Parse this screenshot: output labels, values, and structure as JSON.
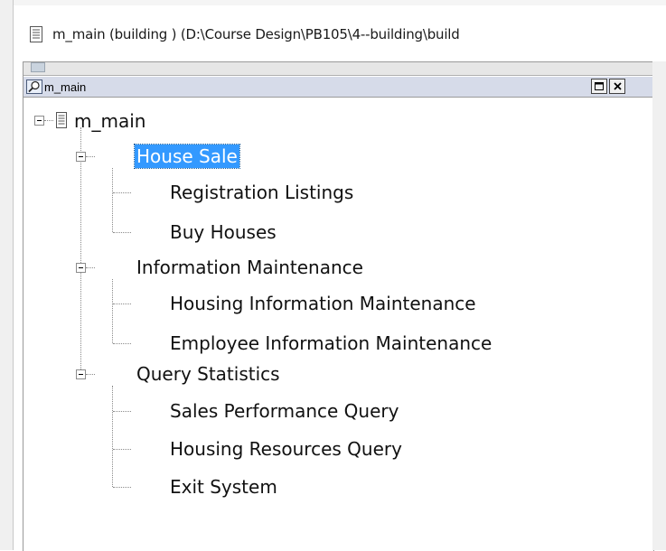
{
  "window": {
    "title": "m_main (building ) (D:\\Course Design\\PB105\\4--building\\build"
  },
  "panel": {
    "title": "m_main",
    "icons": [
      "magnifier-icon",
      "restore-icon",
      "close-icon"
    ]
  },
  "tree": {
    "root": "m_main",
    "groups": [
      {
        "label": "House Sale",
        "selected": true,
        "children": [
          "Registration Listings",
          "Buy Houses"
        ]
      },
      {
        "label": "Information Maintenance",
        "selected": false,
        "children": [
          "Housing Information Maintenance",
          "Employee Information Maintenance"
        ]
      },
      {
        "label": "Query Statistics",
        "selected": false,
        "children": [
          "Sales Performance Query",
          "Housing Resources Query",
          "Exit System"
        ]
      }
    ]
  },
  "colors": {
    "selection": "#3399ff",
    "panel_header": "#d6dbe9"
  }
}
